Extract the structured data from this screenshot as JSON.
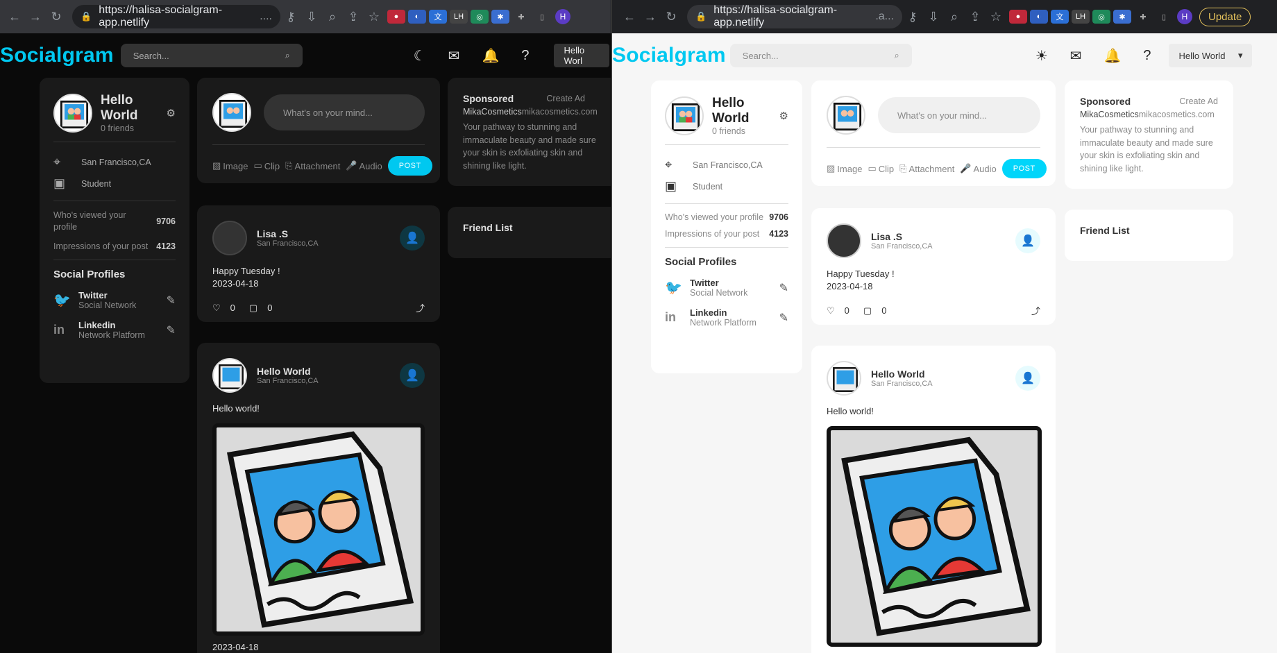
{
  "browser": {
    "url_host": "https://halisa-socialgram-app.netlify",
    "url_dark_suffix": "....",
    "url_light_suffix": ".a...",
    "update_label": "Update",
    "profile_initial": "H"
  },
  "app": {
    "logo": "Socialgram",
    "search_placeholder": "Search...",
    "user_menu": "Hello World",
    "user_menu_dark_truncated": "Hello Worl"
  },
  "profile": {
    "name_line1": "Hello",
    "name_line2": "World",
    "friends": "0 friends",
    "location": "San Francisco,CA",
    "occupation": "Student",
    "viewed_label_dark_1": "Who's viewed your",
    "viewed_label_dark_2": "profile",
    "viewed_label": "Who's viewed your profile",
    "viewed_value": "9706",
    "impressions_label": "Impressions of your post",
    "impressions_value": "4123",
    "social_title": "Social Profiles",
    "socials": [
      {
        "name": "Twitter",
        "type": "Social Network"
      },
      {
        "name": "Linkedin",
        "type": "Network Platform"
      }
    ]
  },
  "composer": {
    "placeholder": "What's on your mind...",
    "options": [
      "Image",
      "Clip",
      "Attachment",
      "Audio"
    ],
    "post_label": "POST"
  },
  "posts": [
    {
      "author": "Lisa .S",
      "location": "San Francisco,CA",
      "text": "Happy Tuesday !",
      "date": "2023-04-18",
      "likes": "0",
      "comments": "0"
    },
    {
      "author": "Hello World",
      "location": "San Francisco,CA",
      "text": "Hello world!",
      "date": "2023-04-18"
    }
  ],
  "ad": {
    "title": "Sponsored",
    "create": "Create Ad",
    "company": "MikaCosmetics",
    "site": "mikacosmetics.com",
    "desc": "Your pathway to stunning and immaculate beauty and made sure your skin is exfoliating skin and shining like light."
  },
  "friends": {
    "title": "Friend List"
  },
  "colors": {
    "accent": "#00c8f0"
  }
}
